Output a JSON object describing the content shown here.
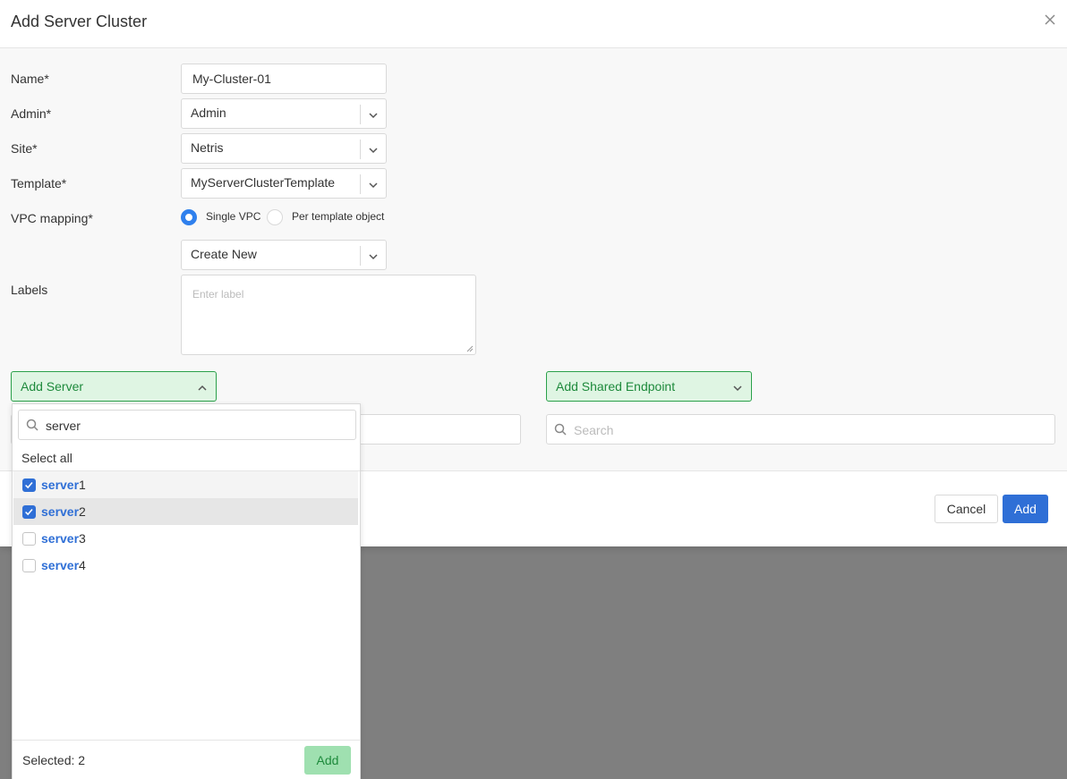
{
  "modal": {
    "title": "Add Server Cluster"
  },
  "form": {
    "name_label": "Name*",
    "name_value": "My-Cluster-01",
    "admin_label": "Admin*",
    "admin_value": "Admin",
    "site_label": "Site*",
    "site_value": "Netris",
    "template_label": "Template*",
    "template_value": "MyServerClusterTemplate",
    "vpc_label": "VPC mapping*",
    "vpc_options": [
      {
        "label": "Single VPC",
        "checked": true
      },
      {
        "label": "Per template object",
        "checked": false
      }
    ],
    "vpc_select_value": "Create New",
    "labels_label": "Labels",
    "labels_placeholder": "Enter label"
  },
  "add_server": {
    "label": "Add Server",
    "search_value": "server",
    "select_all": "Select all",
    "items": [
      {
        "match": "server",
        "suffix": "1",
        "checked": true
      },
      {
        "match": "server",
        "suffix": "2",
        "checked": true
      },
      {
        "match": "server",
        "suffix": "3",
        "checked": false
      },
      {
        "match": "server",
        "suffix": "4",
        "checked": false
      }
    ],
    "selected_text": "Selected: 2",
    "add_label": "Add"
  },
  "shared_endpoint": {
    "label": "Add Shared Endpoint",
    "search_placeholder": "Search"
  },
  "footer": {
    "cancel_label": "Cancel",
    "add_label": "Add"
  },
  "colors": {
    "primary": "#2f6fd6",
    "green_border": "#2aa04a",
    "green_bg": "#dff5e3",
    "overlay": "#7f7f7f"
  },
  "icons": {
    "close": "close-icon",
    "chevron": "chevron-down-icon",
    "search": "search-icon",
    "check": "check-icon"
  }
}
